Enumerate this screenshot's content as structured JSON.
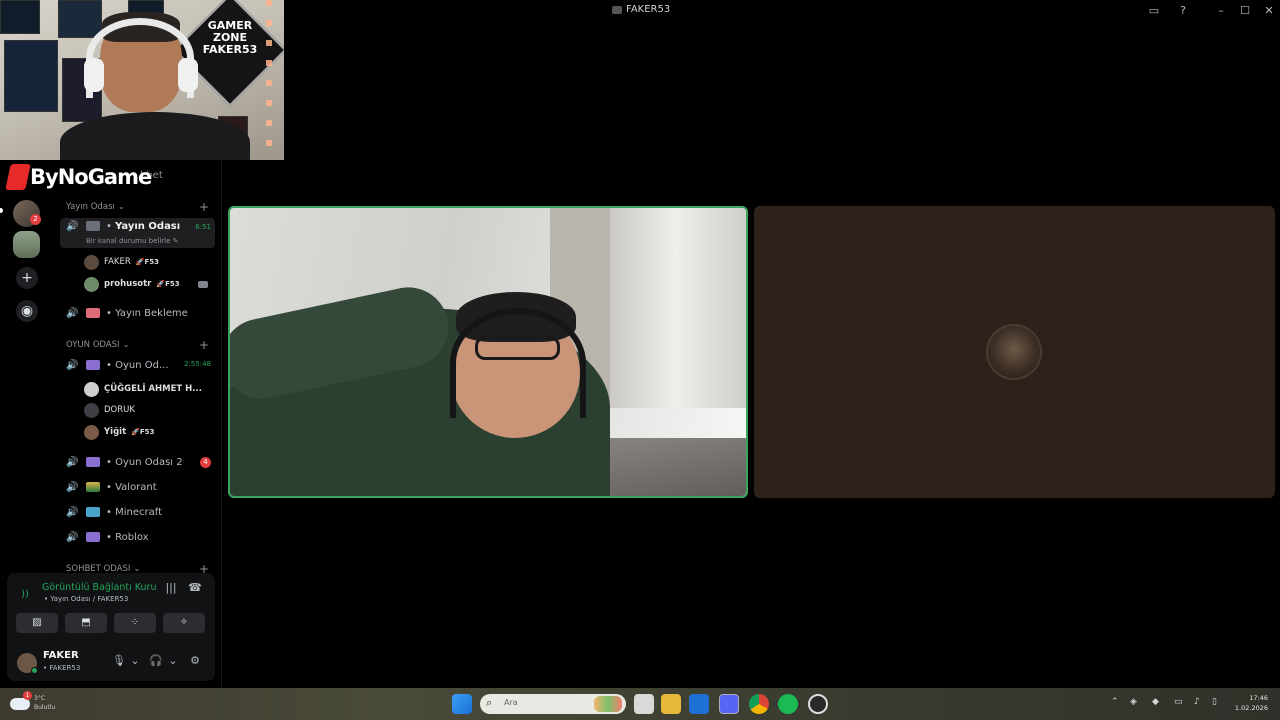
{
  "window": {
    "title": "FAKER53",
    "buttons": {
      "inbox": "▭",
      "help": "?",
      "minimize": "–",
      "maximize": "☐",
      "close": "✕"
    }
  },
  "overlay": {
    "brand": "ByNoGame",
    "partially_hidden_text": "hbet",
    "badge_text_1": "GAMER",
    "badge_text_2": "ZONE",
    "badge_text_3": "FAKER53"
  },
  "servers": {
    "notification_count": "2",
    "add_icon": "+",
    "discover_icon": "◉"
  },
  "channels": {
    "categories": [
      {
        "label": "Yayın Odası",
        "chevron": "⌄"
      },
      {
        "label": "OYUN ODASI",
        "chevron": "⌄"
      },
      {
        "label": "SOHBET ODASI",
        "chevron": "⌄"
      }
    ],
    "plus": "+",
    "yayin_odasi": {
      "name": "Yayın Odası",
      "time": "6:51",
      "status": "Bir kanal durumu belirle ✎",
      "users": [
        {
          "name": "FAKER",
          "tag": "🚀F53"
        },
        {
          "name": "prohusotr",
          "tag": "🚀F53"
        }
      ]
    },
    "yayin_bekleme": {
      "name": "Yayın Bekleme"
    },
    "oyun_odasi": {
      "name": "Oyun Od...",
      "time": "2:55:48",
      "users": [
        {
          "name": "ÇÜĞGELİ AHMET H..."
        },
        {
          "name": "DORUK"
        },
        {
          "name": "Yiğit",
          "tag": "🚀F53"
        }
      ]
    },
    "oyun_odasi_2": {
      "name": "Oyun Odası 2",
      "badge": "4"
    },
    "valorant": {
      "name": "Valorant"
    },
    "minecraft": {
      "name": "Minecraft"
    },
    "roblox": {
      "name": "Roblox"
    },
    "speaker_icon": "🔊",
    "dot_prefix": "•"
  },
  "voice_panel": {
    "status": "Görüntülü Bağlantı Kuru",
    "location": "• Yayın Odası / FAKER53",
    "actions": [
      "▨",
      "⬒",
      "⁘",
      "✧"
    ],
    "noise_icon": "|||",
    "disconnect_icon": "☎"
  },
  "user_panel": {
    "name": "FAKER",
    "sub": "• FAKER53",
    "mic_icon": "🎙",
    "headset_icon": "🎧",
    "settings_icon": "⚙",
    "chevron": "⌄"
  },
  "taskbar": {
    "weather_badge": "1",
    "weather_text_1": "3°C",
    "weather_text_2": "Bulutlu",
    "search_placeholder": "Ara",
    "search_icon": "⌕",
    "clock_time": "17:46",
    "clock_date": "1.02.2026"
  },
  "colors": {
    "accent_green": "#23a55a",
    "active_tile_border": "#3ba55d",
    "notification_red": "#e43d3d",
    "brand_red": "#e62a2a"
  }
}
